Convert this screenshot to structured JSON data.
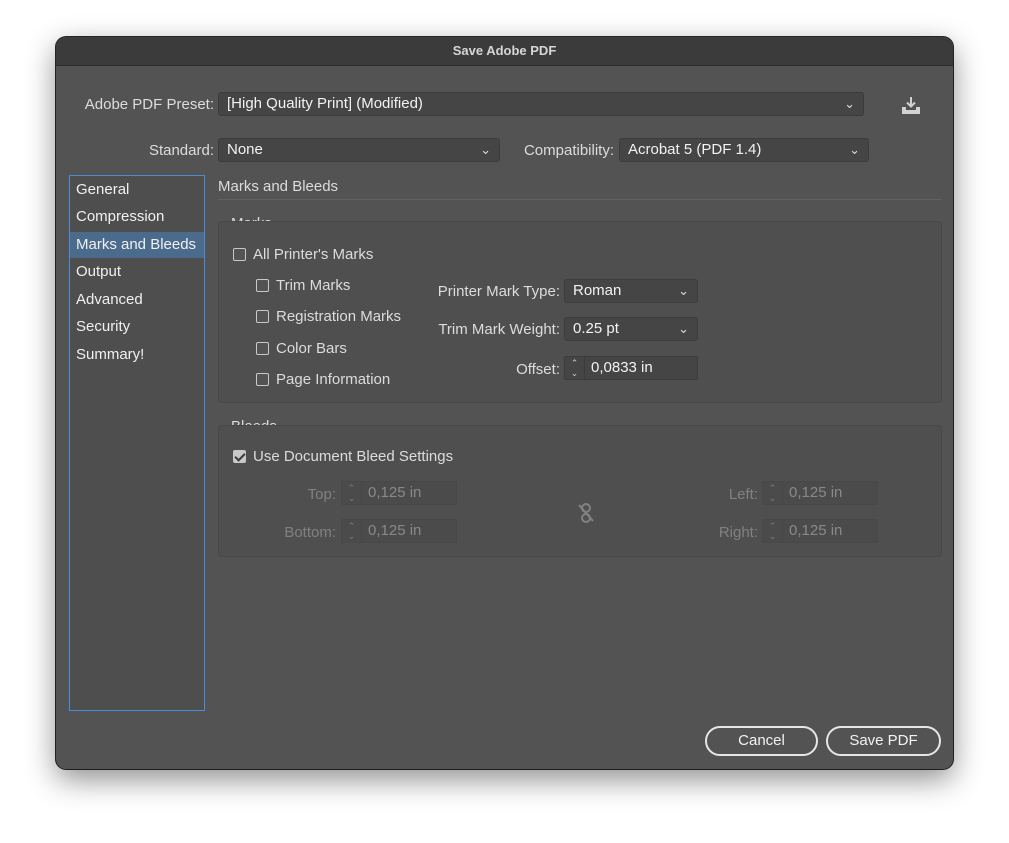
{
  "window": {
    "title": "Save Adobe PDF"
  },
  "preset": {
    "label": "Adobe PDF Preset:",
    "value": "[High Quality Print] (Modified)"
  },
  "standard": {
    "label": "Standard:",
    "value": "None"
  },
  "compatibility": {
    "label": "Compatibility:",
    "value": "Acrobat 5 (PDF 1.4)"
  },
  "sidebar": {
    "items": [
      {
        "label": "General"
      },
      {
        "label": "Compression"
      },
      {
        "label": "Marks and Bleeds"
      },
      {
        "label": "Output"
      },
      {
        "label": "Advanced"
      },
      {
        "label": "Security"
      },
      {
        "label": "Summary!"
      }
    ],
    "active_index": 2
  },
  "panel": {
    "heading": "Marks and Bleeds",
    "marks": {
      "title": "Marks",
      "all_printers_marks": {
        "label": "All Printer's Marks",
        "checked": false
      },
      "checkboxes": [
        {
          "label": "Trim Marks",
          "checked": false
        },
        {
          "label": "Registration Marks",
          "checked": false
        },
        {
          "label": "Color Bars",
          "checked": false
        },
        {
          "label": "Page Information",
          "checked": false
        }
      ],
      "printer_mark_type": {
        "label": "Printer Mark Type:",
        "value": "Roman"
      },
      "trim_mark_weight": {
        "label": "Trim Mark Weight:",
        "value": "0.25 pt"
      },
      "offset": {
        "label": "Offset:",
        "value": "0,0833 in"
      }
    },
    "bleeds": {
      "title": "Bleeds",
      "use_document": {
        "label": "Use Document Bleed Settings",
        "checked": true
      },
      "top": {
        "label": "Top:",
        "value": "0,125 in"
      },
      "bottom": {
        "label": "Bottom:",
        "value": "0,125 in"
      },
      "left": {
        "label": "Left:",
        "value": "0,125 in"
      },
      "right": {
        "label": "Right:",
        "value": "0,125 in"
      }
    }
  },
  "buttons": {
    "cancel": "Cancel",
    "save": "Save PDF"
  },
  "icons": {
    "preset_save": "save-preset-icon",
    "link": "unlink-icon",
    "chevron": "chevron-down-icon"
  },
  "colors": {
    "window_bg": "#535353",
    "selection": "#4b6b8d",
    "focus_border": "#4a8ed8"
  }
}
